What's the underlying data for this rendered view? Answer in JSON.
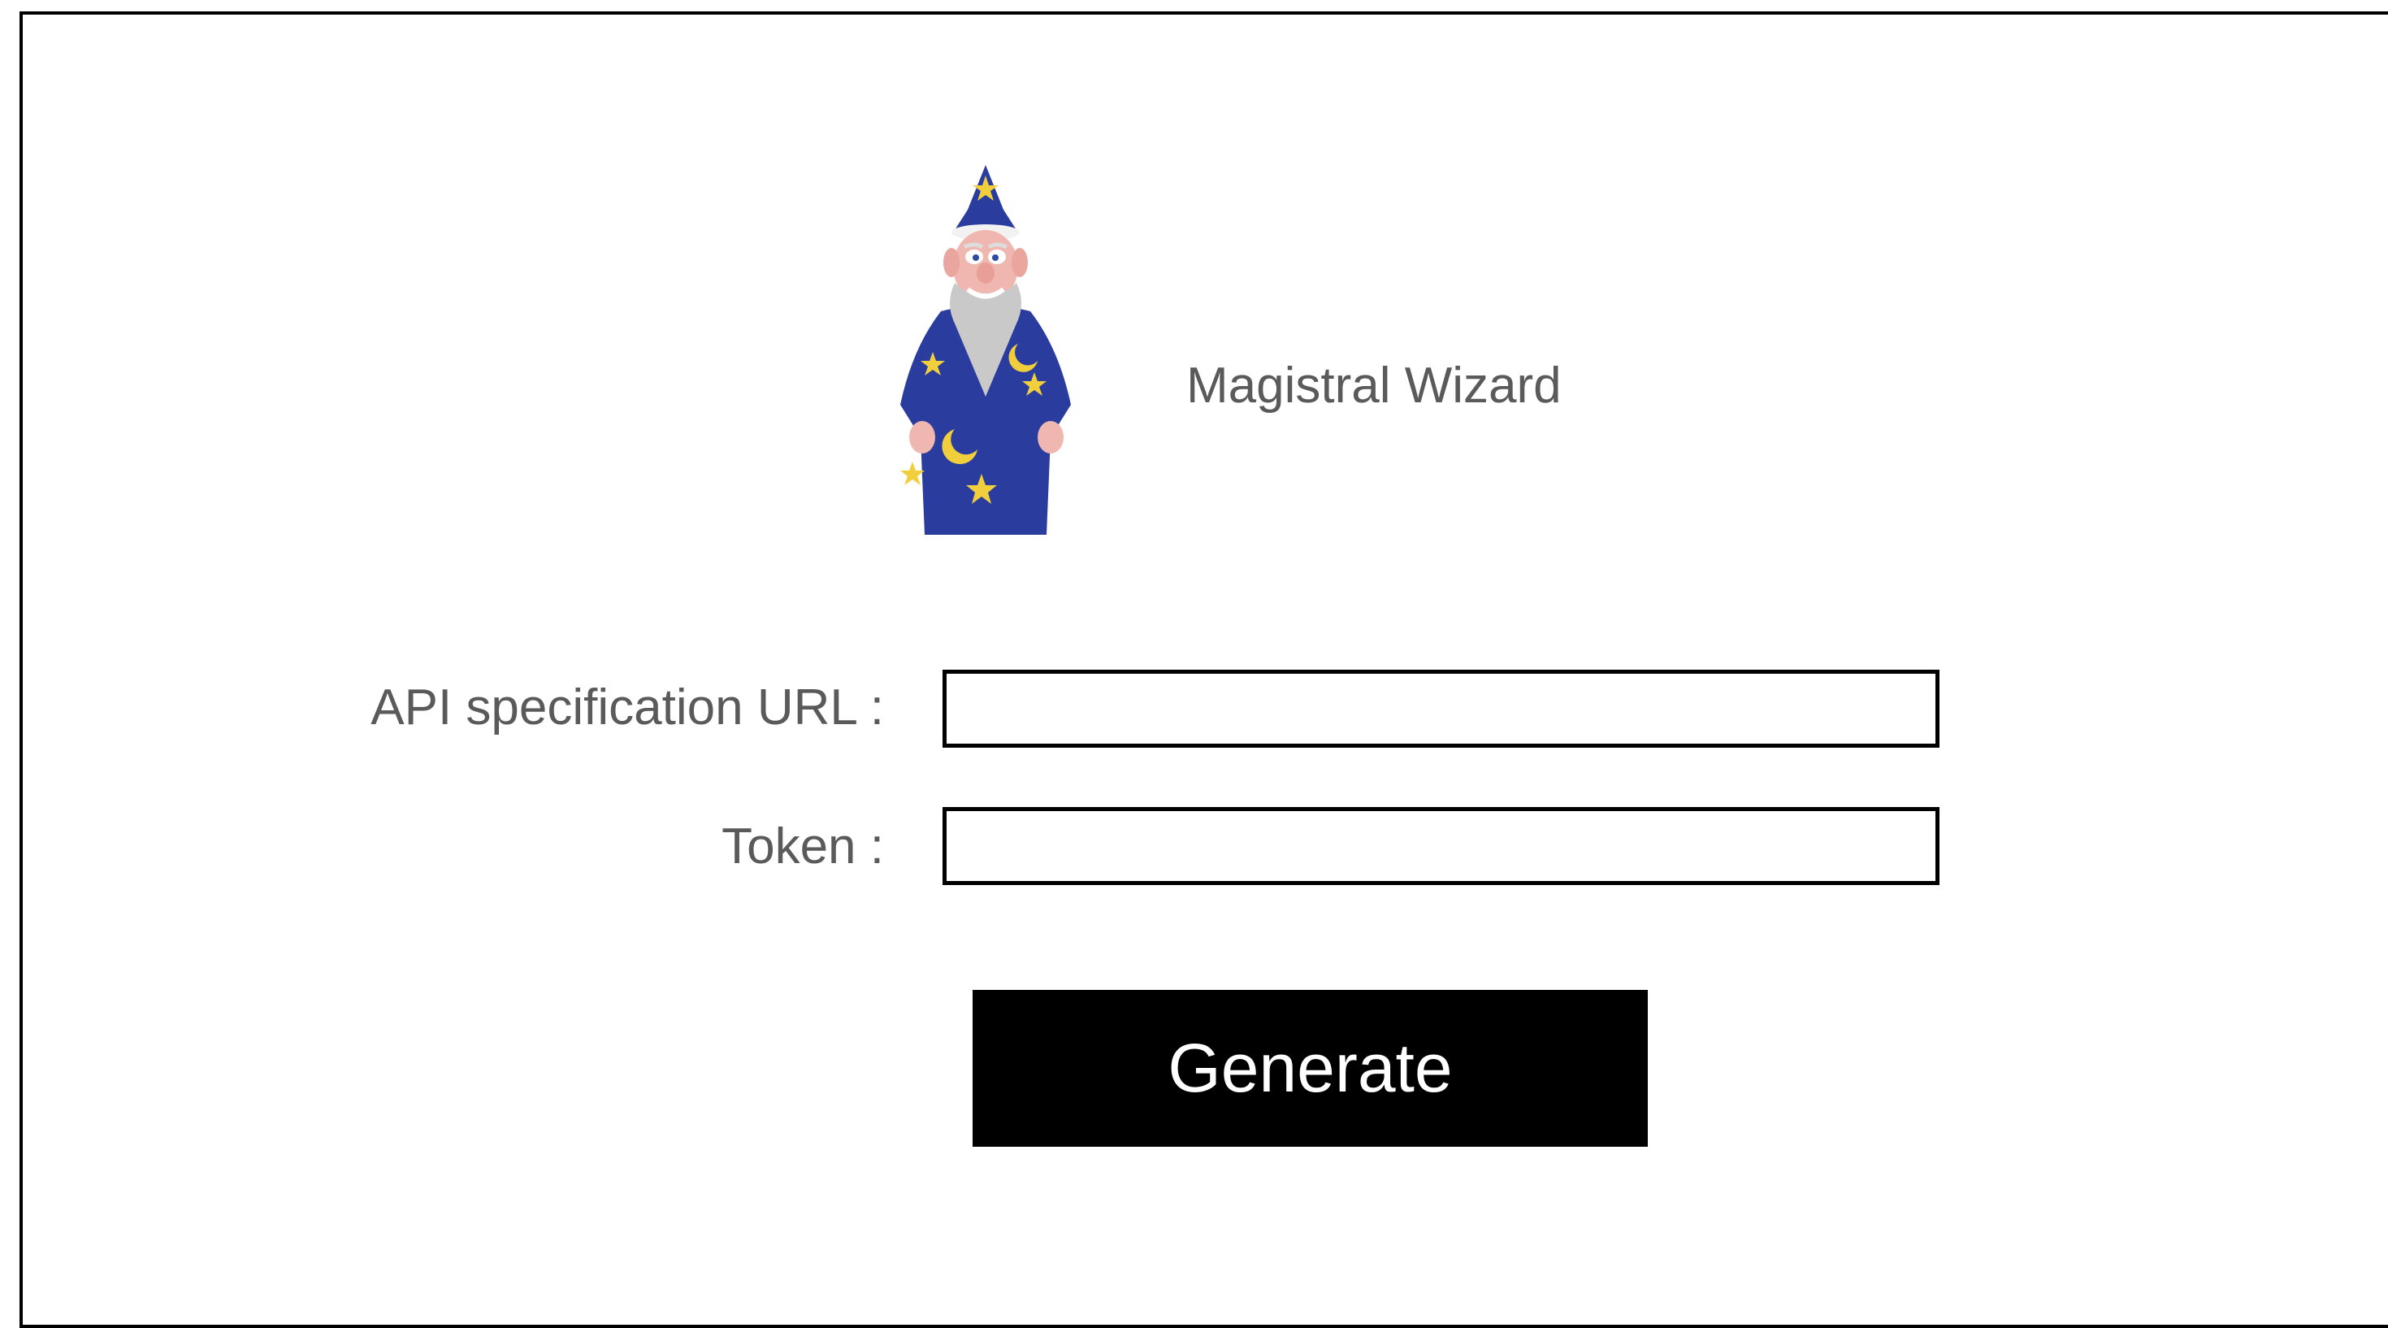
{
  "app": {
    "title": "Magistral Wizard",
    "logo_icon": "wizard-icon"
  },
  "form": {
    "api_url": {
      "label": "API specification URL :",
      "value": "",
      "placeholder": ""
    },
    "token": {
      "label": "Token :",
      "value": "",
      "placeholder": ""
    },
    "generate_label": "Generate"
  },
  "colors": {
    "robe": "#2a3d9e",
    "stars": "#f1cf3c",
    "button": "#000000",
    "text": "#5a5a5a"
  }
}
